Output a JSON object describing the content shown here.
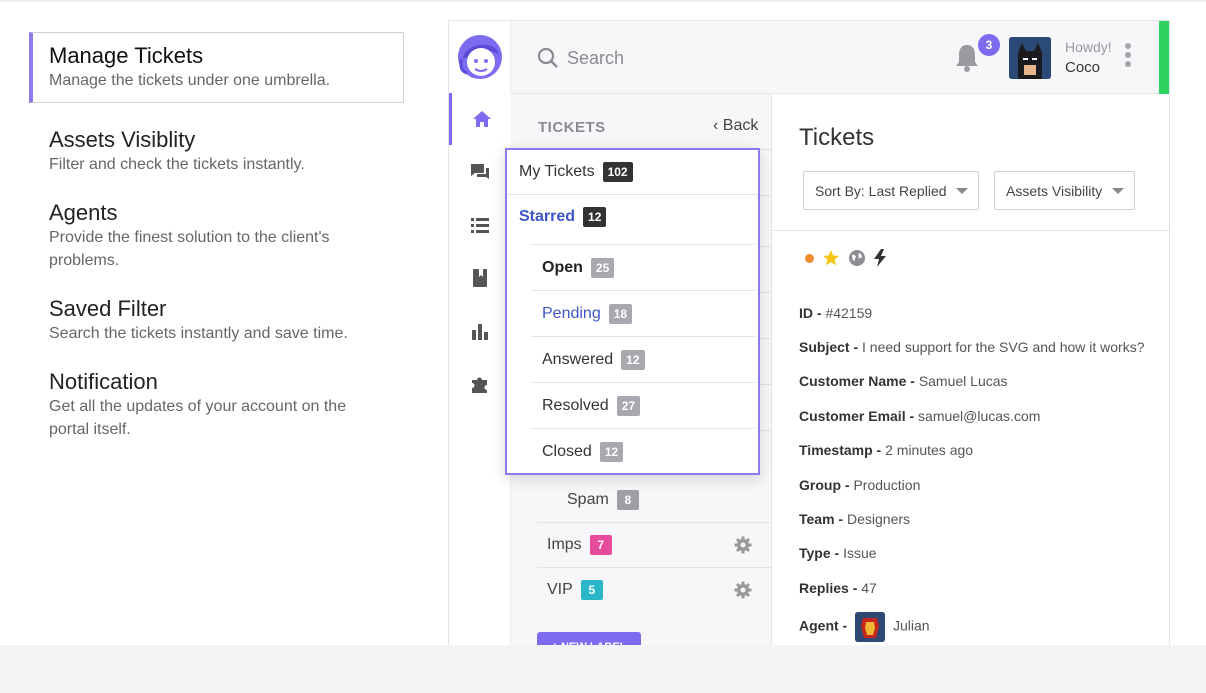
{
  "features": [
    {
      "title": "Manage Tickets",
      "desc": "Manage the tickets under one umbrella.",
      "active": true
    },
    {
      "title": "Assets Visiblity",
      "desc": "Filter and check the tickets instantly."
    },
    {
      "title": "Agents",
      "desc": "Provide the finest solution to the client's problems."
    },
    {
      "title": "Saved Filter",
      "desc": "Search the tickets instantly and save time."
    },
    {
      "title": "Notification",
      "desc": "Get all the updates of your account on the portal itself."
    }
  ],
  "topbar": {
    "search_placeholder": "Search",
    "notification_count": "3",
    "howdy": "Howdy!",
    "user_name": "Coco",
    "add_label": "+"
  },
  "sidebar_icons": [
    "home-icon",
    "chat-icon",
    "list-icon",
    "bookmark-icon",
    "chart-icon",
    "puzzle-icon"
  ],
  "tickets_panel": {
    "heading": "TICKETS",
    "back_label": "Back",
    "rows": [
      {
        "label": "Spam",
        "count": "8",
        "color": "#9e9ea4"
      },
      {
        "label": "Imps",
        "count": "7",
        "color": "#e74c9a"
      },
      {
        "label": "VIP",
        "count": "5",
        "color": "#29b7c9"
      }
    ],
    "new_label_button": "+ NEW LABEL"
  },
  "dropdown": {
    "my_tickets": {
      "label": "My Tickets",
      "count": "102"
    },
    "starred": {
      "label": "Starred",
      "count": "12"
    },
    "items": [
      {
        "label": "Open",
        "count": "25"
      },
      {
        "label": "Pending",
        "count": "18"
      },
      {
        "label": "Answered",
        "count": "12"
      },
      {
        "label": "Resolved",
        "count": "27"
      },
      {
        "label": "Closed",
        "count": "12"
      }
    ]
  },
  "detail": {
    "title": "Tickets",
    "sort_label": "Sort By: Last Replied",
    "assets_label": "Assets Visibility",
    "fields": [
      {
        "key": "ID -",
        "value": "#42159"
      },
      {
        "key": "Subject -",
        "value": "I need support for the SVG and how it works?"
      },
      {
        "key": "Customer Name -",
        "value": "Samuel Lucas"
      },
      {
        "key": "Customer Email -",
        "value": "samuel@lucas.com"
      },
      {
        "key": "Timestamp -",
        "value": "2 minutes ago"
      },
      {
        "key": "Group -",
        "value": "Production"
      },
      {
        "key": "Team -",
        "value": "Designers"
      },
      {
        "key": "Type -",
        "value": "Issue"
      },
      {
        "key": "Replies -",
        "value": "47"
      }
    ],
    "agent": {
      "key": "Agent -",
      "value": "Julian"
    }
  },
  "colors": {
    "accent": "#7b6cf0",
    "add": "#2fd160",
    "count_dark": "#333333",
    "count_grey": "#a8a8ae"
  }
}
